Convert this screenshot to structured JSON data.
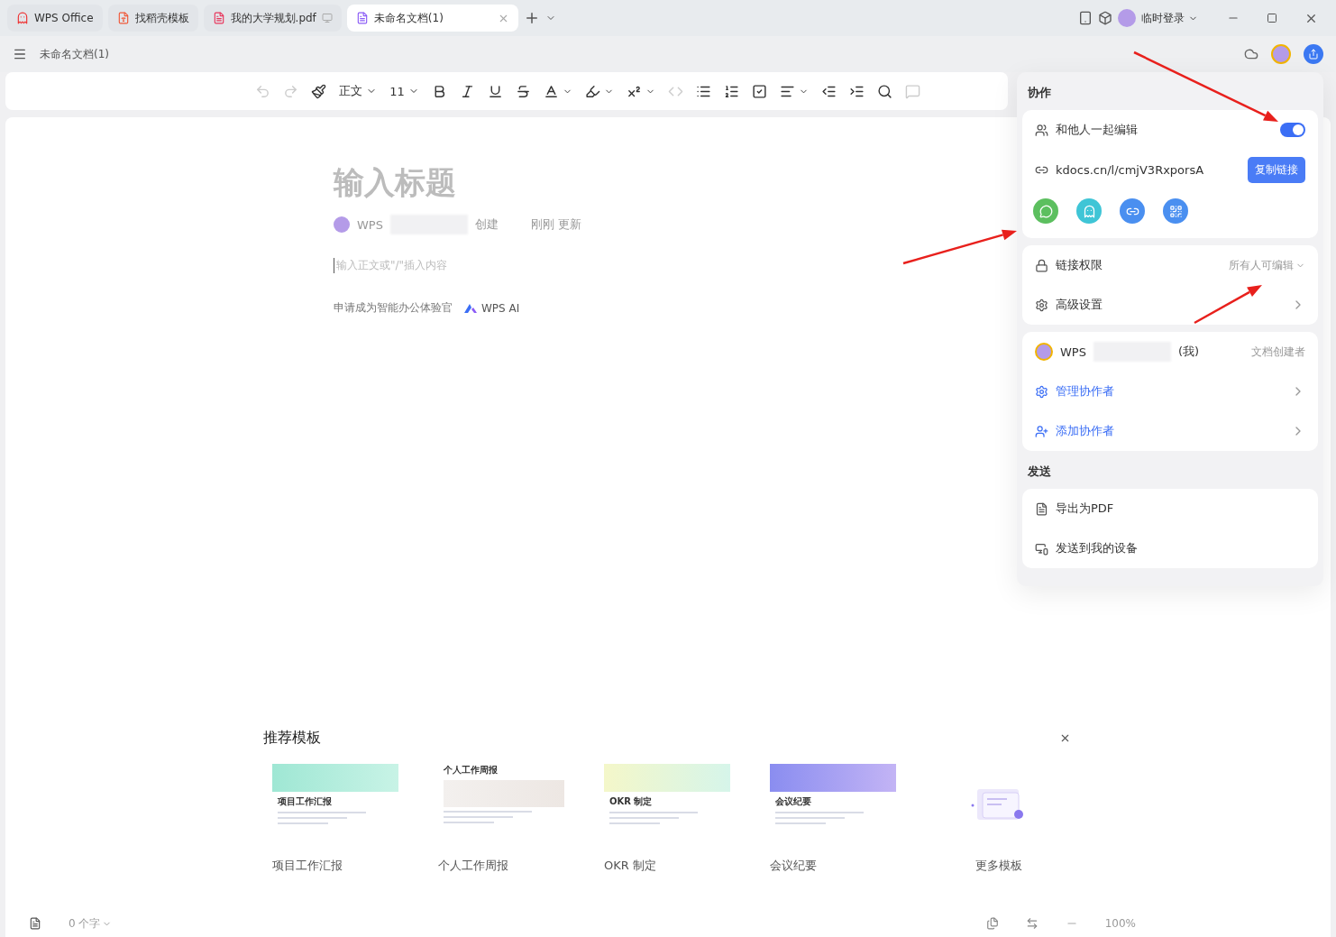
{
  "tabs": [
    {
      "label": "WPS Office",
      "kind": "home",
      "selected": false
    },
    {
      "label": "找稻壳模板",
      "kind": "template",
      "selected": false
    },
    {
      "label": "我的大学规划.pdf",
      "kind": "pdf",
      "selected": false
    },
    {
      "label": "未命名文档(1)",
      "kind": "doc",
      "selected": true
    }
  ],
  "account": {
    "label": "临时登录"
  },
  "doc_title": "未命名文档(1)",
  "toolbar": [
    {
      "kind": "undo",
      "disabled": true
    },
    {
      "kind": "redo",
      "disabled": true
    },
    {
      "kind": "painter",
      "disabled": false
    },
    {
      "kind": "select",
      "label": "正文",
      "disabled": false
    },
    {
      "kind": "select",
      "label": "11",
      "disabled": false
    },
    {
      "kind": "bold",
      "disabled": false
    },
    {
      "kind": "italic",
      "disabled": false
    },
    {
      "kind": "underline",
      "disabled": false
    },
    {
      "kind": "strike",
      "disabled": false
    },
    {
      "kind": "color",
      "disabled": false
    },
    {
      "kind": "highlight",
      "disabled": false
    },
    {
      "kind": "superscript",
      "disabled": false
    },
    {
      "kind": "code",
      "disabled": true
    },
    {
      "kind": "bullets",
      "disabled": false
    },
    {
      "kind": "numbers",
      "disabled": false
    },
    {
      "kind": "todo",
      "disabled": false
    },
    {
      "kind": "align",
      "disabled": false
    },
    {
      "kind": "outdent",
      "disabled": false
    },
    {
      "kind": "indent",
      "disabled": false
    },
    {
      "kind": "search",
      "disabled": false
    },
    {
      "kind": "comment",
      "disabled": true
    }
  ],
  "document": {
    "title_placeholder": "输入标题",
    "author": "WPS",
    "created": "创建",
    "updated": "刚刚 更新",
    "body_placeholder": "输入正文或\"/\"插入内容",
    "ai_invite": "申请成为智能办公体验官",
    "ai_label": "WPS AI"
  },
  "panel": {
    "title": "协作",
    "collab": {
      "label": "和他人一起编辑",
      "on": true
    },
    "link": {
      "url": "kdocs.cn/l/cmjV3RxporsA",
      "button": "复制链接"
    },
    "share": [
      {
        "kind": "wechat",
        "color": "#5cbf5f"
      },
      {
        "kind": "qq",
        "color": "#3fc5d6"
      },
      {
        "kind": "link",
        "color": "#4a8ff0"
      },
      {
        "kind": "qrcode",
        "color": "#4a8ff0"
      }
    ],
    "permission": {
      "label": "链接权限",
      "value": "所有人可编辑"
    },
    "advanced": "高级设置",
    "member": {
      "name": "WPS",
      "me": "(我)",
      "role": "文档创建者"
    },
    "actions": [
      {
        "kind": "manage",
        "label": "管理协作者"
      },
      {
        "kind": "add",
        "label": "添加协作者"
      }
    ],
    "send_title": "发送",
    "send": [
      {
        "kind": "pdf",
        "label": "导出为PDF"
      },
      {
        "kind": "device",
        "label": "发送到我的设备"
      }
    ]
  },
  "templates": {
    "title": "推荐模板",
    "items": [
      {
        "name": "项目工作汇报",
        "preview": "项目工作汇报",
        "kind": "green"
      },
      {
        "name": "个人工作周报",
        "preview": "个人工作周报",
        "kind": "plain"
      },
      {
        "name": "OKR 制定",
        "preview": "OKR 制定",
        "kind": "yellow"
      },
      {
        "name": "会议纪要",
        "preview": "会议纪要",
        "kind": "purple"
      }
    ],
    "more": "更多模板"
  },
  "status": {
    "words": "0 个字",
    "zoom": "100%"
  }
}
